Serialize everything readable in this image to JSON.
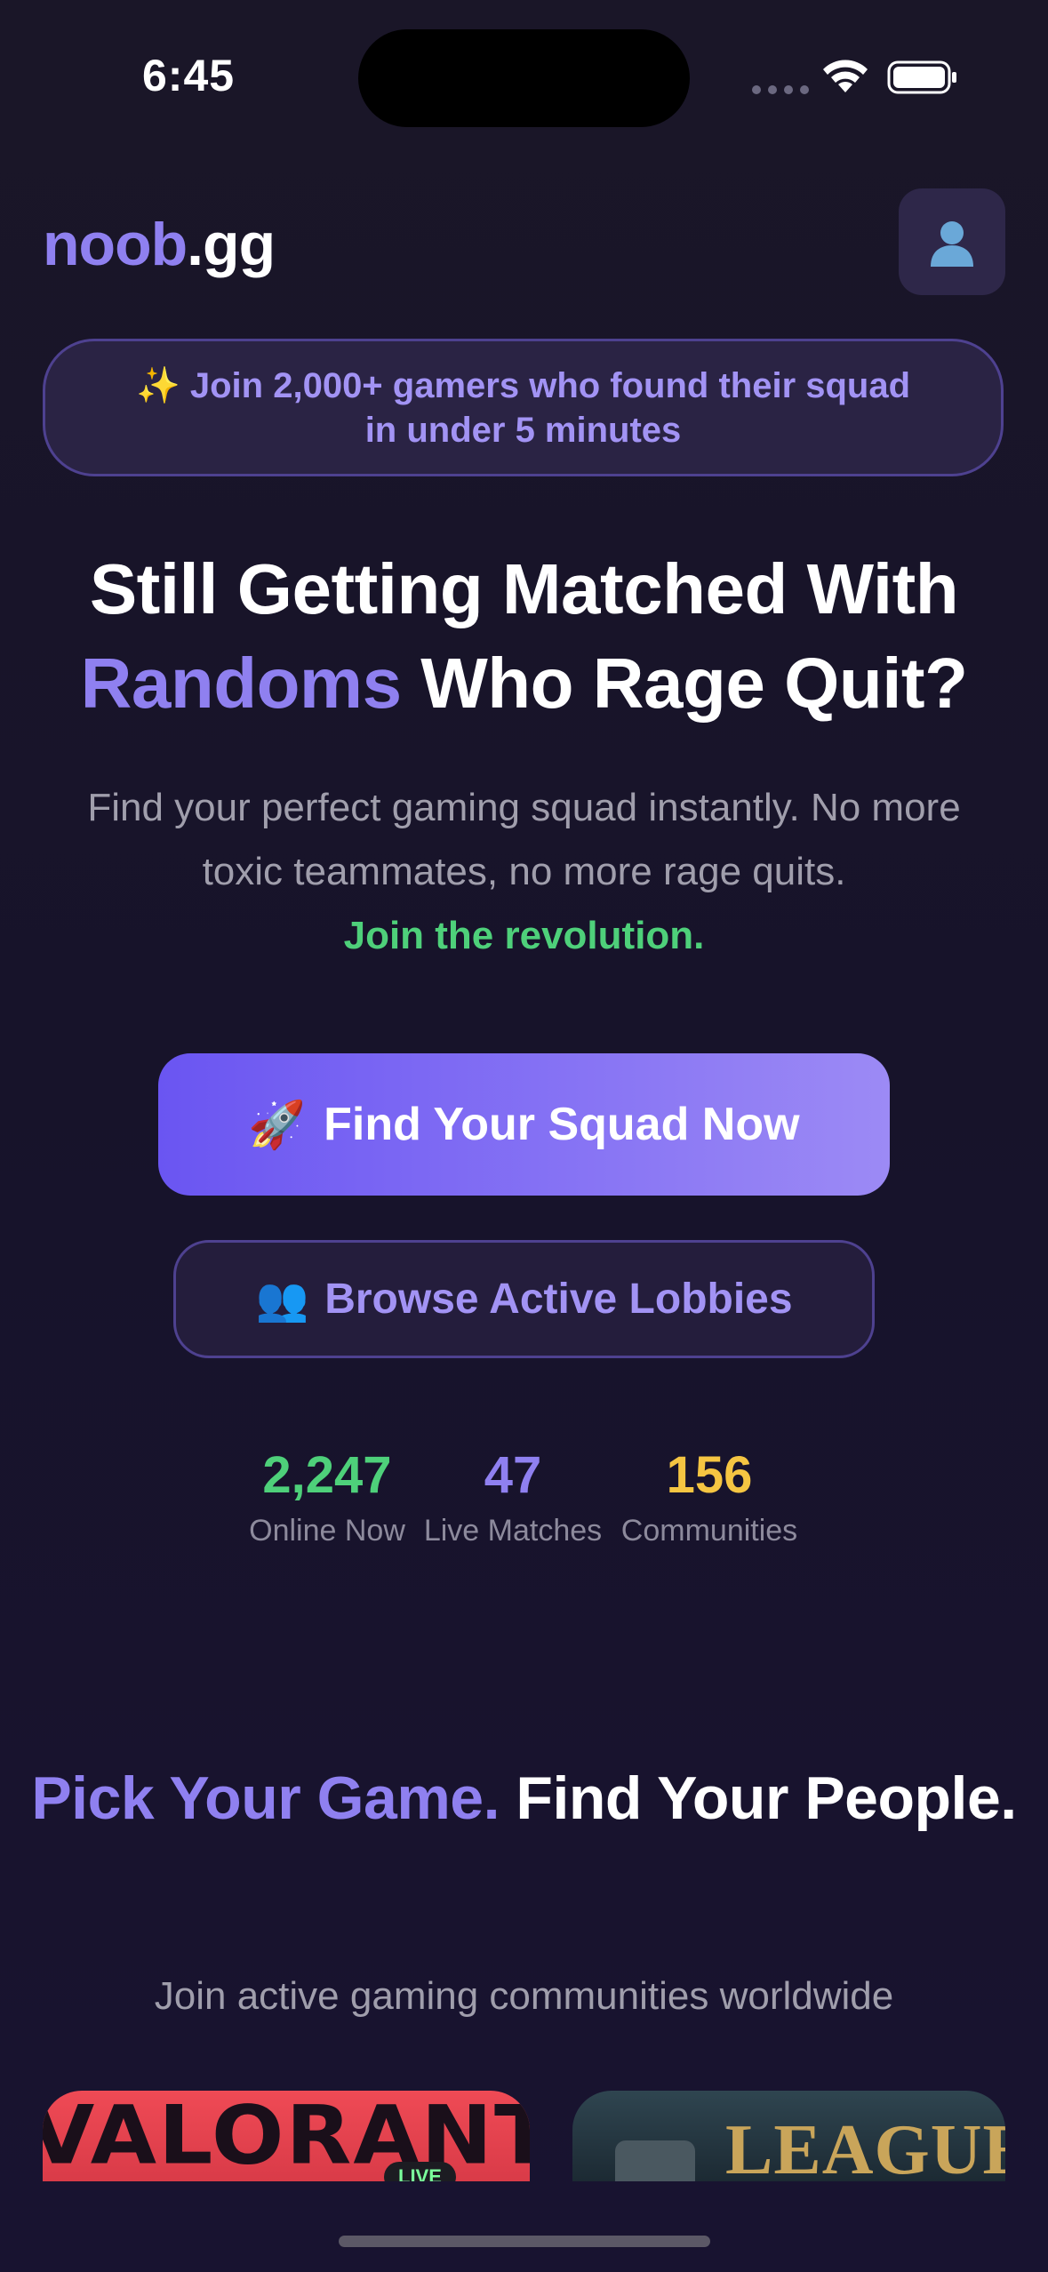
{
  "status_bar": {
    "time": "6:45"
  },
  "header": {
    "logo_accent": "noob",
    "logo_rest": ".gg",
    "profile_icon": "user-icon"
  },
  "banner": {
    "text": "✨ Join 2,000+ gamers who found their squad in under 5 minutes"
  },
  "hero": {
    "title_line1": "Still Getting Matched With",
    "title_accent": "Randoms",
    "title_line2_rest": " Who Rage Quit?",
    "subtitle": "Find your perfect gaming squad instantly. No more toxic teammates, no more rage quits.",
    "subtitle_highlight": "Join the revolution.",
    "primary_button": {
      "icon": "🚀",
      "label": "Find Your Squad Now"
    },
    "secondary_button": {
      "icon": "👥",
      "label": "Browse Active Lobbies"
    }
  },
  "stats": [
    {
      "value": "2,247",
      "label": "Online Now",
      "color": "#4ed07a"
    },
    {
      "value": "47",
      "label": "Live Matches",
      "color": "#8f80f0"
    },
    {
      "value": "156",
      "label": "Communities",
      "color": "#f5c542"
    }
  ],
  "games_section": {
    "title_accent": "Pick Your Game.",
    "title_rest": "Find Your People.",
    "subtitle": "Join active gaming communities worldwide",
    "cards": [
      {
        "name": "VALORANT",
        "badge": "LIVE"
      },
      {
        "name": "LEAGUE"
      }
    ]
  },
  "colors": {
    "accent": "#8f80f0",
    "background": "#1a1628",
    "green": "#4ed07a",
    "yellow": "#f5c542"
  }
}
